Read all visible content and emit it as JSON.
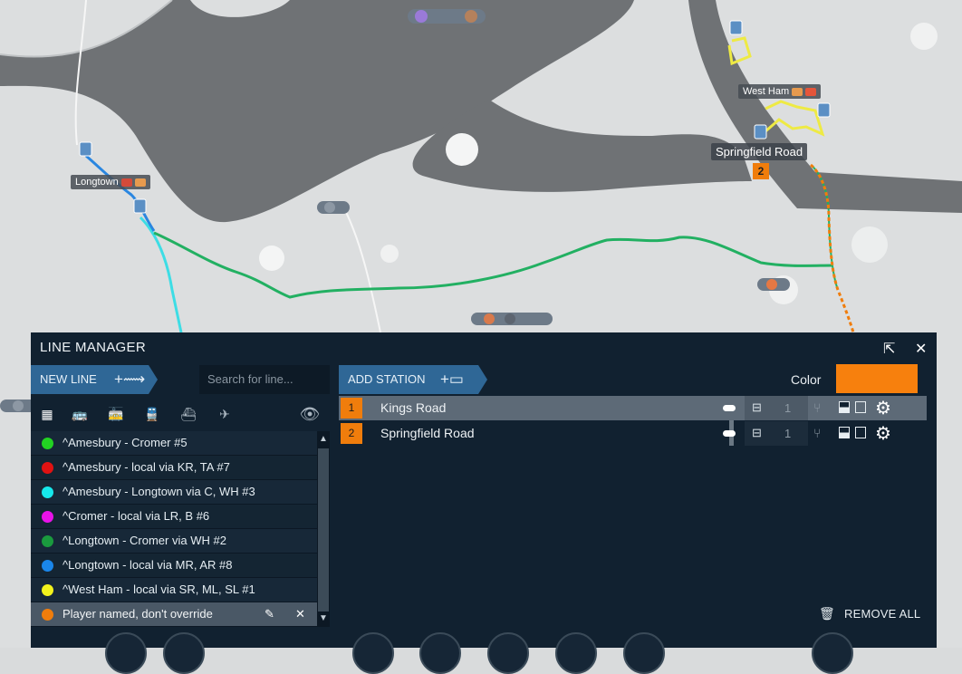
{
  "map": {
    "towns": [
      {
        "name": "Longtown"
      },
      {
        "name": "West Ham"
      }
    ],
    "station_label": "Springfield Road",
    "station_number": "2"
  },
  "panel": {
    "title": "LINE MANAGER",
    "popout_icon": "popout-icon",
    "close_icon": "close-icon",
    "new_line_label": "NEW LINE",
    "search_placeholder": "Search for line...",
    "add_station_label": "ADD STATION",
    "color_label": "Color",
    "line_color": "#f7800d",
    "remove_all_label": "REMOVE ALL",
    "filters": [
      "all-grid-icon",
      "bus-icon",
      "tram-icon",
      "train-icon",
      "ship-icon",
      "plane-icon"
    ],
    "visibility_icon": "eye-icon"
  },
  "lines": [
    {
      "name": "^Amesbury - Cromer #5",
      "color": "#22d222"
    },
    {
      "name": "^Amesbury - local via KR, TA #7",
      "color": "#e01212"
    },
    {
      "name": "^Amesbury - Longtown via C, WH #3",
      "color": "#16e8ec"
    },
    {
      "name": "^Cromer - local via LR, B #6",
      "color": "#e812e8"
    },
    {
      "name": "^Longtown - Cromer via WH #2",
      "color": "#1a9a3e"
    },
    {
      "name": "^Longtown - local via MR, AR #8",
      "color": "#1a86ea"
    },
    {
      "name": "^West Ham - local via SR, ML, SL #1",
      "color": "#f2f21c"
    },
    {
      "name": "Player named, don't override",
      "color": "#f07d0c"
    }
  ],
  "stations": [
    {
      "index": "1",
      "name": "Kings Road",
      "vehicles": "1"
    },
    {
      "index": "2",
      "name": "Springfield Road",
      "vehicles": "1"
    }
  ]
}
